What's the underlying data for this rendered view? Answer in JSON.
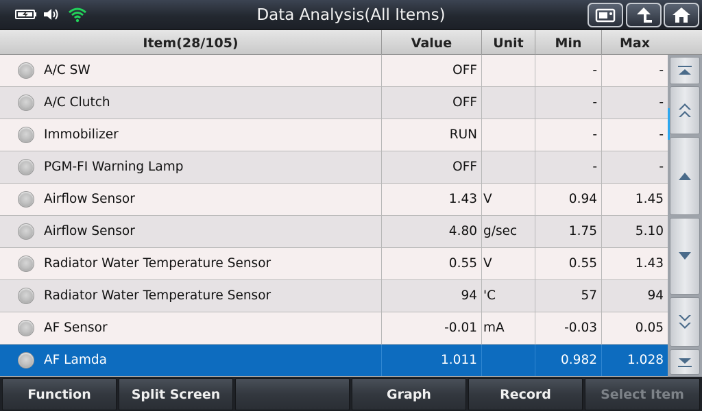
{
  "header": {
    "title": "Data Analysis(All Items)",
    "icons": [
      "battery-icon",
      "speaker-icon",
      "wifi-icon",
      "screenshot-icon",
      "back-icon",
      "home-icon"
    ]
  },
  "table": {
    "columns": {
      "item": "Item(28/105)",
      "value": "Value",
      "unit": "Unit",
      "min": "Min",
      "max": "Max"
    },
    "rows": [
      {
        "name": "A/C SW",
        "value": "OFF",
        "unit": "",
        "min": "-",
        "max": "-"
      },
      {
        "name": "A/C Clutch",
        "value": "OFF",
        "unit": "",
        "min": "-",
        "max": "-"
      },
      {
        "name": "Immobilizer",
        "value": "RUN",
        "unit": "",
        "min": "-",
        "max": "-"
      },
      {
        "name": "PGM-FI Warning Lamp",
        "value": "OFF",
        "unit": "",
        "min": "-",
        "max": "-"
      },
      {
        "name": "Airflow Sensor",
        "value": "1.43",
        "unit": "V",
        "min": "0.94",
        "max": "1.45"
      },
      {
        "name": "Airflow Sensor",
        "value": "4.80",
        "unit": "g/sec",
        "min": "1.75",
        "max": "5.10"
      },
      {
        "name": "Radiator Water Temperature Sensor",
        "value": "0.55",
        "unit": "V",
        "min": "0.55",
        "max": "1.43"
      },
      {
        "name": "Radiator Water Temperature Sensor",
        "value": "94",
        "unit": "'C",
        "min": "57",
        "max": "94"
      },
      {
        "name": "AF Sensor",
        "value": "-0.01",
        "unit": "mA",
        "min": "-0.03",
        "max": "0.05"
      },
      {
        "name": "AF Lamda",
        "value": "1.011",
        "unit": "",
        "min": "0.982",
        "max": "1.028"
      }
    ],
    "selected_row": 9
  },
  "footer": {
    "function": "Function",
    "split_screen": "Split Screen",
    "empty": "",
    "graph": "Graph",
    "record": "Record",
    "select_item": "Select Item"
  },
  "colors": {
    "selected_row": "#0d6cbf",
    "scroll_indicator": "#2aa7f0",
    "wifi": "#22d35a"
  }
}
